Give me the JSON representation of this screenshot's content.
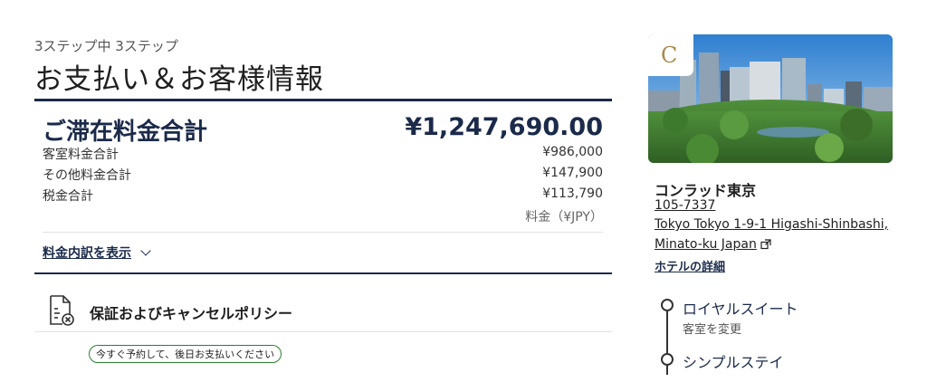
{
  "header": {
    "step": "3ステップ中 3ステップ",
    "title": "お支払い＆お客様情報"
  },
  "summary": {
    "total_label": "ご滞在料金合計",
    "total_value": "¥1,247,690.00",
    "rows": [
      {
        "label": "客室料金合計",
        "value": "¥986,000"
      },
      {
        "label": "その他料金合計",
        "value": "¥147,900"
      },
      {
        "label": "税金合計",
        "value": "¥113,790"
      }
    ],
    "currency_note": "料金（¥JPY）",
    "breakdown_link": "料金内訳を表示"
  },
  "policy": {
    "title": "保証およびキャンセルポリシー",
    "badge": "今すぐ予約して、後日お支払いください",
    "cutoff_text": "　　　　　　　　　　　　　　　　　　　"
  },
  "hotel": {
    "logo_letter": "C",
    "name": "コンラッド東京",
    "code": "105-7337",
    "address_line1": "Tokyo Tokyo 1-9-1 Higashi-Shinbashi,",
    "address_line2": "Minato-ku Japan",
    "detail_link": "ホテルの詳細"
  },
  "rooms": [
    {
      "name": "ロイヤルスイート",
      "change": "客室を変更"
    },
    {
      "name": "シンプルステイ"
    }
  ],
  "colors": {
    "navy": "#1b2a4a",
    "badge_green": "#2e7d32",
    "logo_gold": "#a88a4a"
  },
  "icons": [
    "document-cancel-icon",
    "external-link-icon",
    "chevron-down-icon"
  ]
}
